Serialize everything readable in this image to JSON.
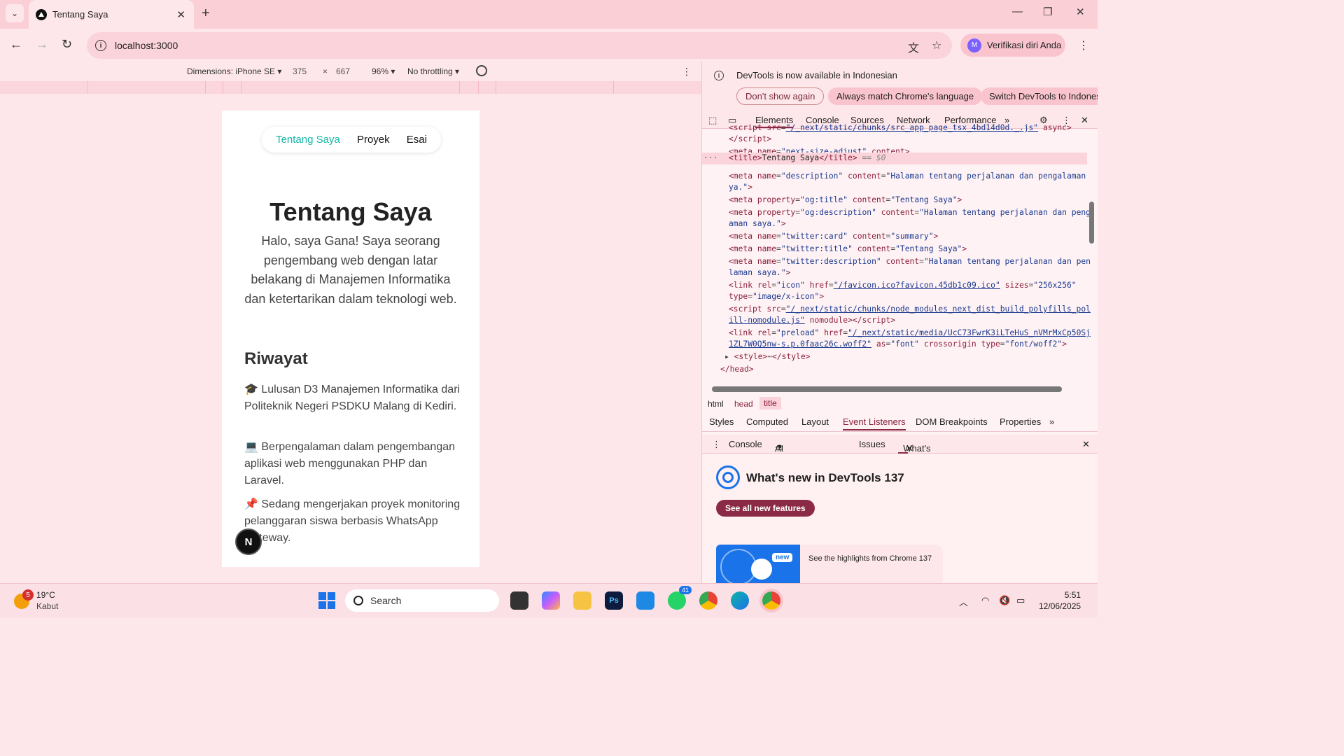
{
  "browser": {
    "tab_title": "Tentang Saya",
    "url": "localhost:3000",
    "profile_label": "Verifikasi diri Anda",
    "profile_initial": "M"
  },
  "device_toolbar": {
    "dimensions_label": "Dimensions: iPhone SE",
    "width": "375",
    "height": "667",
    "zoom": "96%",
    "throttling": "No throttling"
  },
  "page": {
    "nav": [
      "Tentang Saya",
      "Proyek",
      "Esai"
    ],
    "title": "Tentang Saya",
    "intro": "Halo, saya Gana! Saya seorang pengembang web dengan latar belakang di Manajemen Informatika dan ketertarikan dalam teknologi web.",
    "section_title": "Riwayat",
    "items": [
      "🎓 Lulusan D3 Manajemen Informatika dari Politeknik Negeri PSDKU Malang di Kediri.",
      "💻 Berpengalaman dalam pengembangan aplikasi web menggunakan PHP dan Laravel.",
      "📌 Sedang mengerjakan proyek monitoring pelanggaran siswa berbasis WhatsApp Gateway."
    ],
    "badge": "N"
  },
  "devtools": {
    "info_message": "DevTools is now available in Indonesian",
    "btn_dont_show": "Don't show again",
    "btn_match": "Always match Chrome's language",
    "btn_switch": "Switch DevTools to Indonesi",
    "tabs": [
      "Elements",
      "Console",
      "Sources",
      "Network",
      "Performance"
    ],
    "breadcrumbs": [
      "html",
      "head",
      "title"
    ],
    "sub_tabs": [
      "Styles",
      "Computed",
      "Layout",
      "Event Listeners",
      "DOM Breakpoints",
      "Properties"
    ],
    "drawer_tabs": [
      "Console",
      "AI assistance",
      "Issues",
      "What's new"
    ],
    "whatsnew_title": "What's new in DevTools 137",
    "whatsnew_button": "See all new features",
    "whatsnew_card_text": "See the highlights from Chrome 137",
    "whatsnew_new_badge": "new",
    "selected_marker": "== $0"
  },
  "taskbar": {
    "weather_temp": "19°C",
    "weather_cond": "Kabut",
    "weather_badge": "5",
    "search_label": "Search",
    "whatsapp_badge": "41",
    "time": "5:51",
    "date": "12/06/2025"
  },
  "colors": {
    "accent": "#14b8a6",
    "devtools_accent": "#8a2a45",
    "chrome_frame": "#fbcfd6"
  }
}
